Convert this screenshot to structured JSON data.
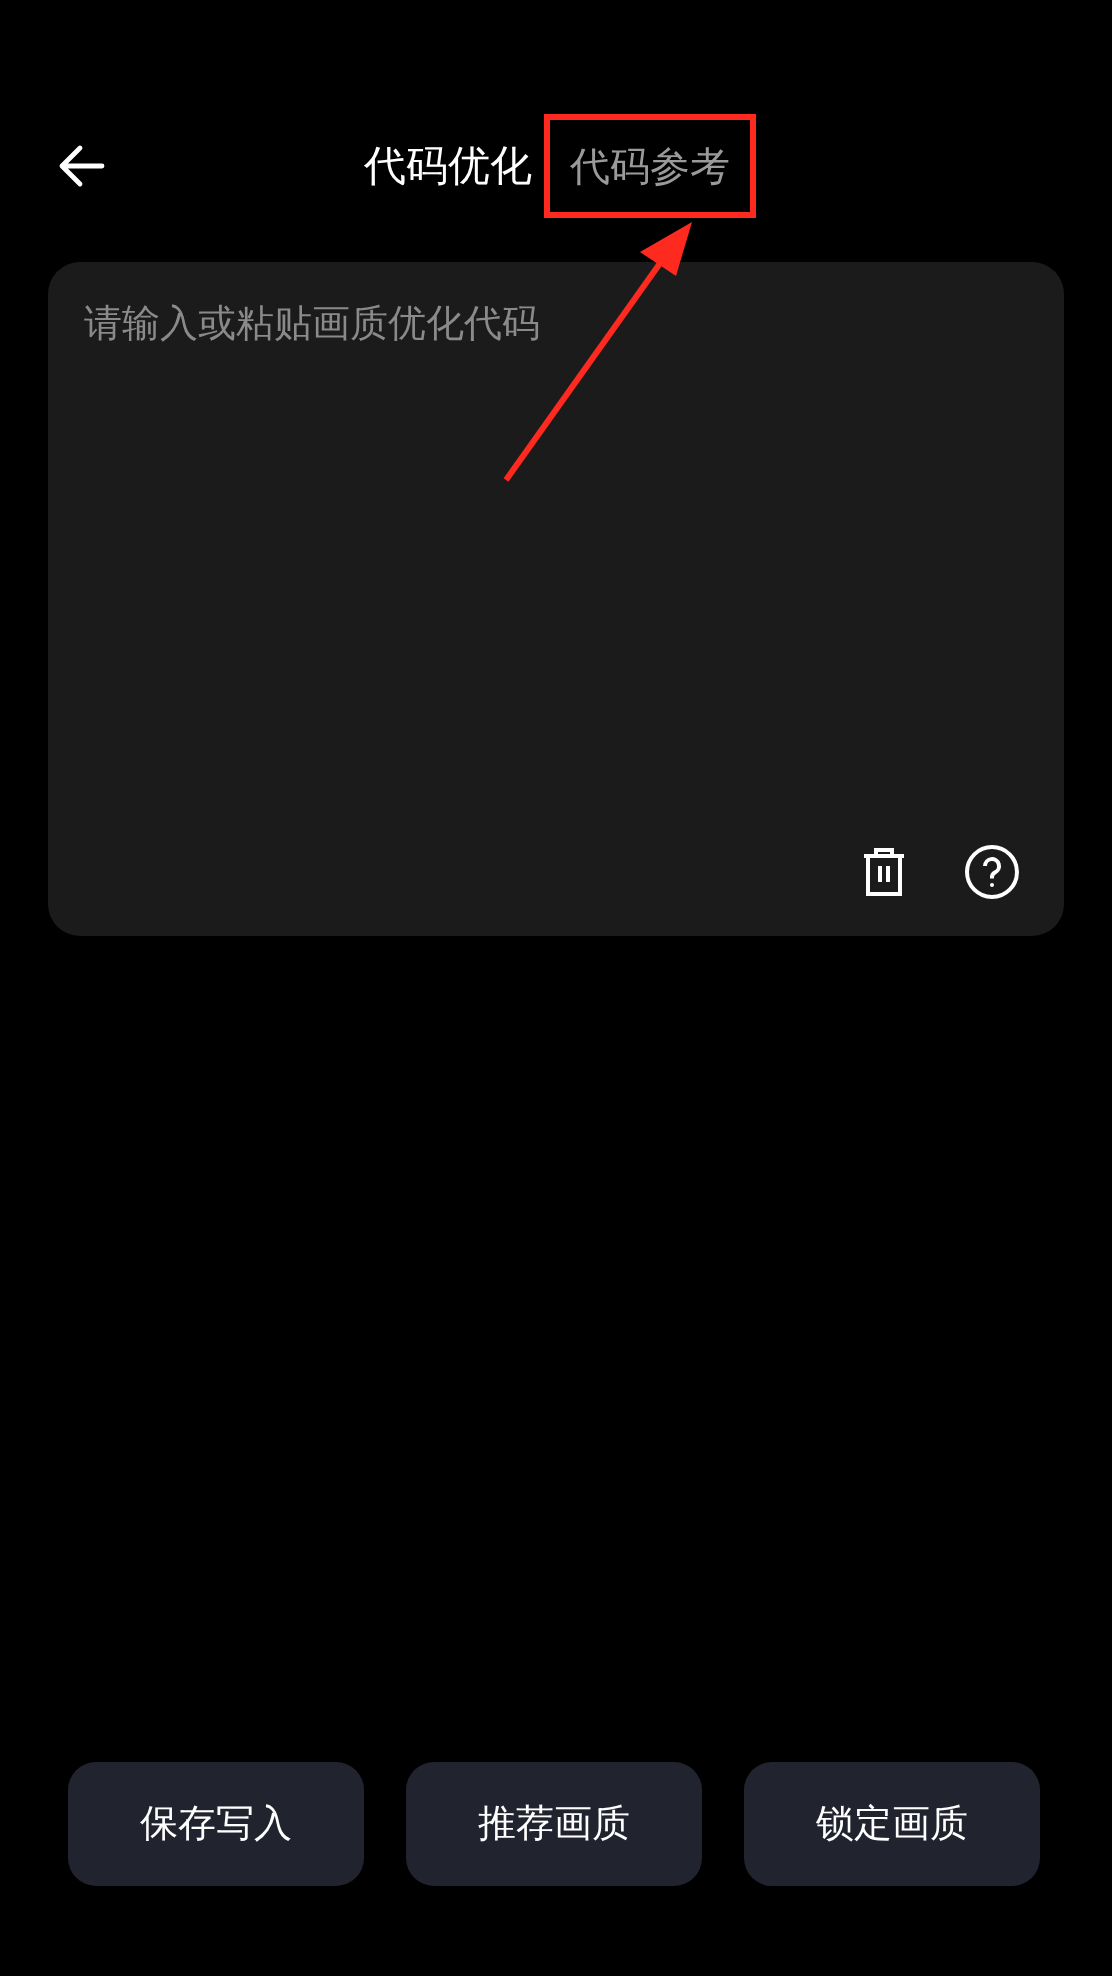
{
  "header": {
    "title": "代码优化",
    "reference_link": {
      "label": "代码参考",
      "highlighted": true
    }
  },
  "editor": {
    "placeholder": "请输入或粘贴画质优化代码"
  },
  "buttons": [
    {
      "label": "保存写入"
    },
    {
      "label": "推荐画质"
    },
    {
      "label": "锁定画质"
    }
  ]
}
